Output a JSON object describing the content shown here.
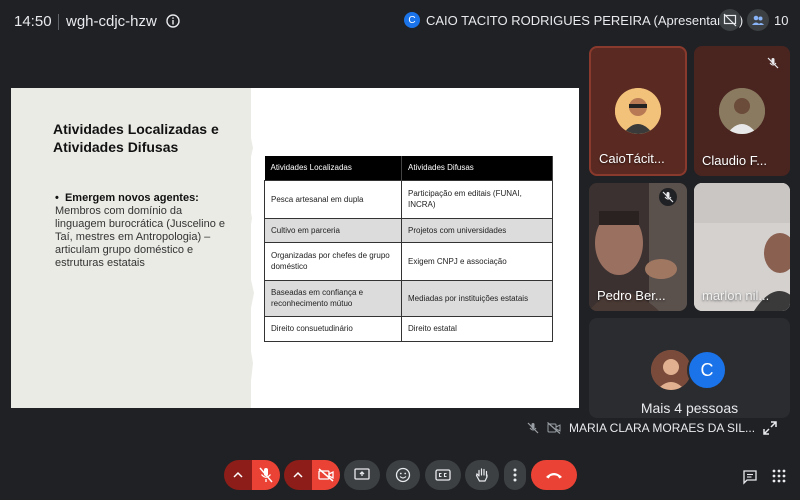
{
  "header": {
    "time": "14:50",
    "meeting_code": "wgh-cdjc-hzw",
    "presenter_initial": "C",
    "presenter_label": "CAIO TACITO RODRIGUES PEREIRA (Apresentando)",
    "participant_count": "10"
  },
  "slide": {
    "title": "Atividades Localizadas e Atividades Difusas",
    "bullet_bold": "Emergem novos agentes:",
    "bullet_text": " Membros com domínio da linguagem burocrática (Juscelino e Taí, mestres em Antropologia) – articulam grupo doméstico e estruturas estatais",
    "table": {
      "headers": [
        "Atividades Localizadas",
        "Atividades Difusas"
      ],
      "rows": [
        [
          "Pesca artesanal em dupla",
          "Participação em editais (FUNAI, INCRA)"
        ],
        [
          "Cultivo em parceria",
          "Projetos com universidades"
        ],
        [
          "Organizadas por chefes de grupo doméstico",
          "Exigem CNPJ e associação"
        ],
        [
          "Baseadas em confiança e reconhecimento mútuo",
          "Mediadas por instituições estatais"
        ],
        [
          "Direito consuetudinário",
          "Direito estatal"
        ]
      ]
    }
  },
  "participants": [
    {
      "name": "CaioTácit...",
      "muted": false
    },
    {
      "name": "Claudio F...",
      "muted": true
    },
    {
      "name": "Pedro Ber...",
      "muted": true
    },
    {
      "name": "marlon nil...",
      "muted": false
    }
  ],
  "more": {
    "avatar_initial": "C",
    "label": "Mais 4 pessoas"
  },
  "presenter_strip": {
    "name": "MARIA CLARA MORAES DA SIL..."
  },
  "colors": {
    "background": "#202124",
    "accent_blue": "#1a73e8",
    "danger_red": "#ea4335"
  }
}
